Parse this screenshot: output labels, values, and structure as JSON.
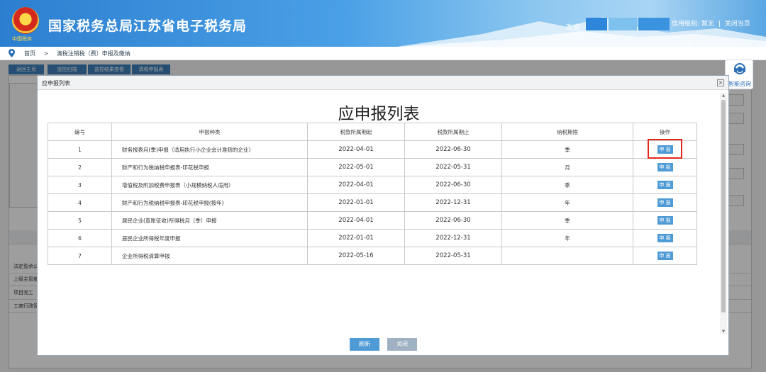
{
  "header": {
    "site_title": "国家税务总局江苏省电子税务局",
    "emblem_caption": "中国税务",
    "welcome": "欢迎",
    "credit_level_label": "信用级别:",
    "credit_level_value": "暂无",
    "separator": "|",
    "close_page": "关闭当页"
  },
  "breadcrumb": {
    "home": "首页",
    "separator": ">",
    "current": "清税注销税（费）申报及缴纳"
  },
  "subtabs": [
    "返回主页",
    "监控扫描",
    "监控结果查看",
    "清税申报表"
  ],
  "background_labels": [
    "法定盈余公",
    "上级主管部",
    "项目完工",
    "工商行政管"
  ],
  "help": {
    "label": "智能咨询"
  },
  "modal": {
    "header_title": "应申报列表",
    "close_glyph": "×",
    "title": "应申报列表",
    "columns": [
      "编号",
      "申报种类",
      "税款所属期起",
      "税款所属期止",
      "纳税期限",
      "操作"
    ],
    "rows": [
      {
        "no": "1",
        "name": "财务报表月(季)申报（适用执行小企业会计准则的企业）",
        "start": "2022-04-01",
        "end": "2022-06-30",
        "period": "季",
        "action": "申 报"
      },
      {
        "no": "2",
        "name": "财产和行为税纳税申报表-印花税申报",
        "start": "2022-05-01",
        "end": "2022-05-31",
        "period": "月",
        "action": "申 报"
      },
      {
        "no": "3",
        "name": "增值税及附加税费申报表（小规模纳税人适用）",
        "start": "2022-04-01",
        "end": "2022-06-30",
        "period": "季",
        "action": "申 报"
      },
      {
        "no": "4",
        "name": "财产和行为税纳税申报表-印花税申报(按年)",
        "start": "2022-01-01",
        "end": "2022-12-31",
        "period": "年",
        "action": "申 报"
      },
      {
        "no": "5",
        "name": "居民企业(查账征收)所得税月（季）申报",
        "start": "2022-04-01",
        "end": "2022-06-30",
        "period": "季",
        "action": "申 报"
      },
      {
        "no": "6",
        "name": "居民企业所得税年度申报",
        "start": "2022-01-01",
        "end": "2022-12-31",
        "period": "年",
        "action": "申 报"
      },
      {
        "no": "7",
        "name": "企业所得税清算申报",
        "start": "2022-05-16",
        "end": "2022-05-31",
        "period": "",
        "action": "申 报"
      }
    ],
    "refresh_label": "刷新",
    "close_label": "关闭"
  },
  "colors": {
    "header_blue": "#2c7fd0",
    "button_blue": "#4f9bd6",
    "highlight_red": "#e3281a"
  }
}
